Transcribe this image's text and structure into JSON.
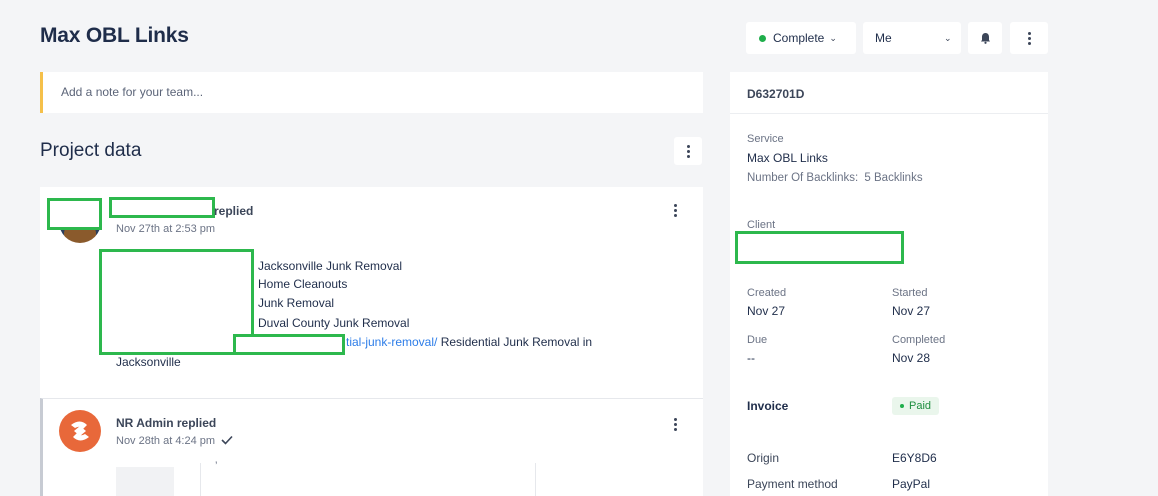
{
  "header": {
    "title": "Max OBL Links"
  },
  "note": {
    "placeholder": "Add a note for your team..."
  },
  "project": {
    "section_title": "Project data"
  },
  "messages": [
    {
      "replied_label": "replied",
      "time": "Nov 27th at 2:53 pm",
      "lines": [
        "Jacksonville Junk Removal",
        "Home Cleanouts",
        "Junk Removal",
        "Duval County Junk Removal"
      ],
      "link_text": "tial-junk-removal/",
      "link_tail": " Residential Junk Removal in",
      "last_line": "Jacksonville"
    },
    {
      "author_line": "NR Admin replied",
      "time": "Nov 28th at 4:24 pm",
      "status_icon": "check-icon",
      "fragment": "’"
    }
  ],
  "toolbar": {
    "status_label": "Complete",
    "status_color": "#1fae4b",
    "assignee_label": "Me"
  },
  "order": {
    "id": "D632701D",
    "service_label": "Service",
    "service_value": "Max OBL Links",
    "backlinks_label": "Number Of Backlinks:",
    "backlinks_value": "5 Backlinks",
    "client_label": "Client",
    "created_label": "Created",
    "created_value": "Nov 27",
    "started_label": "Started",
    "started_value": "Nov 27",
    "due_label": "Due",
    "due_value": "--",
    "completed_label": "Completed",
    "completed_value": "Nov 28",
    "invoice_label": "Invoice",
    "invoice_status": "Paid",
    "origin_label": "Origin",
    "origin_value": "E6Y8D6",
    "payment_label": "Payment method",
    "payment_value": "PayPal"
  }
}
